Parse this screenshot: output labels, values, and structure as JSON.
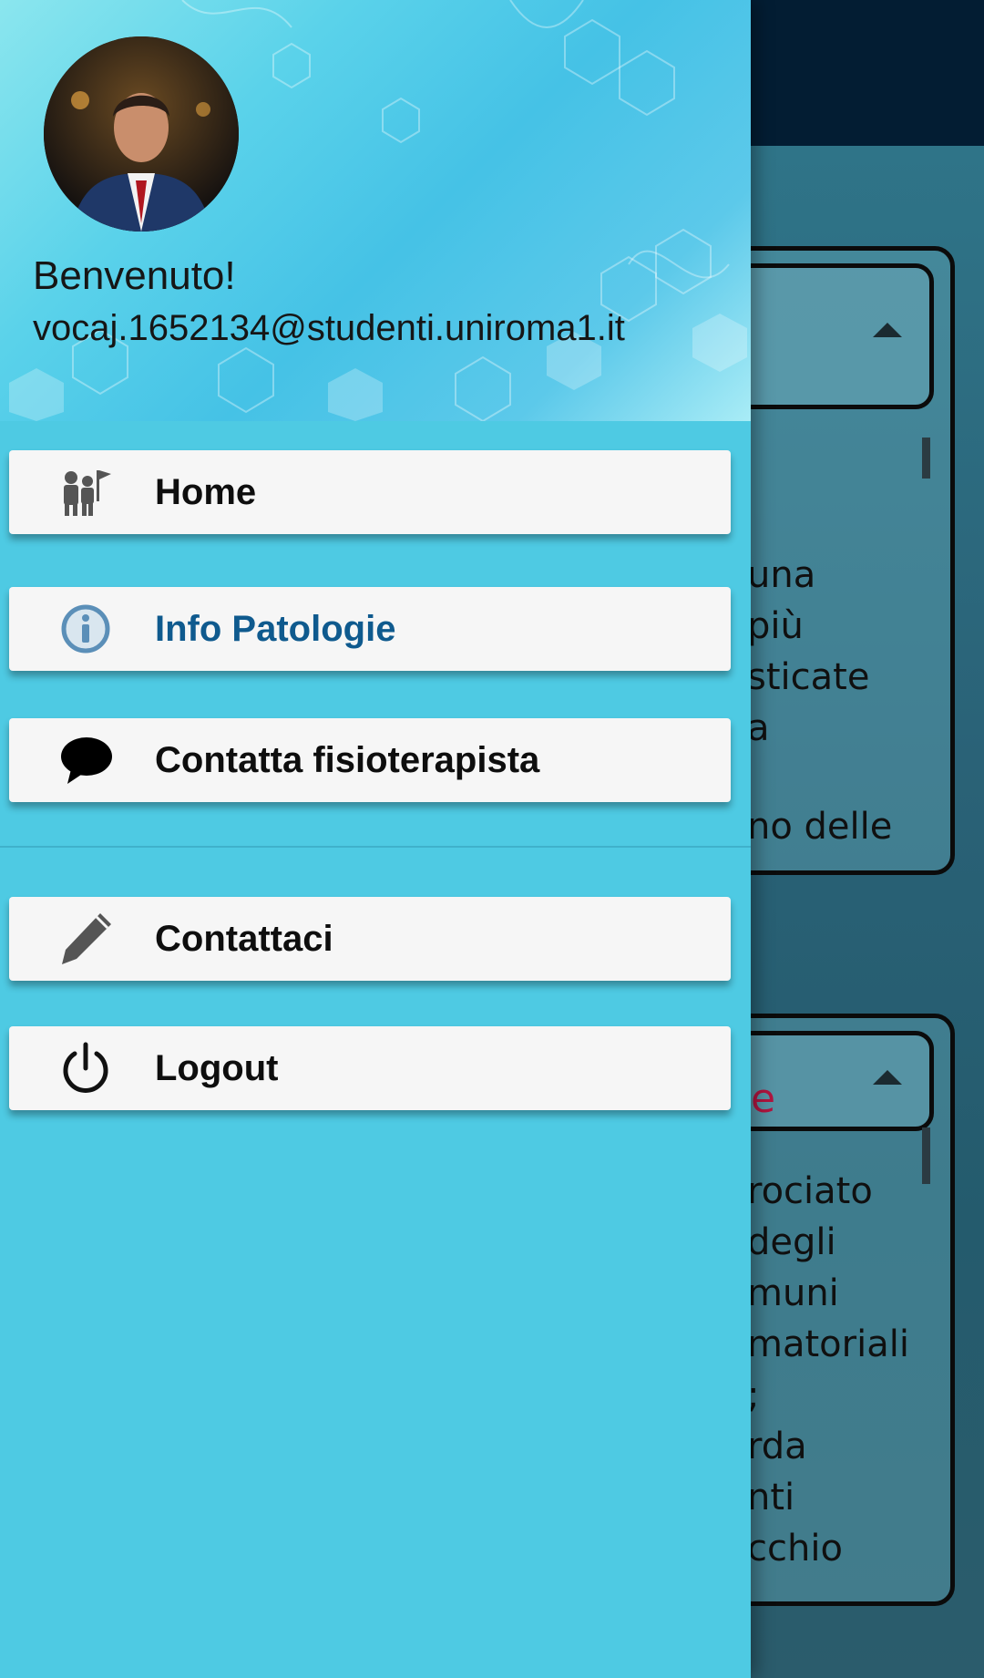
{
  "drawer": {
    "welcome": "Benvenuto!",
    "email": "vocaj.1652134@studenti.uniroma1.it",
    "items": [
      {
        "label": "Home",
        "icon": "people-flag-icon",
        "active": false
      },
      {
        "label": "Info Patologie",
        "icon": "info-icon",
        "active": true
      },
      {
        "label": "Contatta fisioterapista",
        "icon": "speech-bubble-icon",
        "active": false
      },
      {
        "label": "Contattaci",
        "icon": "pencil-icon",
        "active": false
      },
      {
        "label": "Logout",
        "icon": "power-icon",
        "active": false
      }
    ]
  },
  "background": {
    "card1_lines": [
      "una",
      "più",
      "sticate",
      "a",
      "",
      "no delle"
    ],
    "card2_header_fragment": "e",
    "card2_lines": [
      "rociato",
      "degli",
      "muni",
      "matoriali",
      ";",
      "rda",
      "nti",
      "cchio"
    ]
  },
  "colors": {
    "drawer_bg": "#4ecae3",
    "active_label": "#0f5a8e",
    "topbar": "#031d33"
  }
}
